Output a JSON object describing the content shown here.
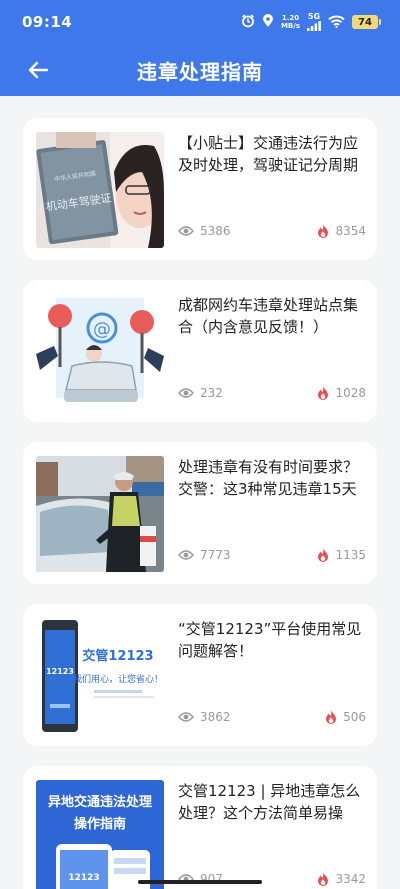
{
  "status_bar": {
    "time": "09:14",
    "net_speed_value": "1.20",
    "net_speed_unit": "MB/s",
    "signal_label": "5G",
    "battery": "74"
  },
  "header": {
    "title": "违章处理指南"
  },
  "colors": {
    "header_bg": "#3f78ea",
    "page_bg": "#f4f5f7",
    "hot_icon": "#ee4d4d"
  },
  "articles": [
    {
      "title": "【小贴士】交通违法行为应及时处理，驾驶证记分周期",
      "views": "5386",
      "hot": "8354",
      "thumb_icon": "license-photo"
    },
    {
      "title": "成都网约车违章处理站点集合（内含意见反馈！）",
      "views": "232",
      "hot": "1028",
      "thumb_icon": "ride-hailing-illustration"
    },
    {
      "title": "处理违章有没有时间要求？交警：这3种常见违章15天",
      "views": "7773",
      "hot": "1135",
      "thumb_icon": "traffic-police-photo"
    },
    {
      "title": "“交管12123”平台使用常见问题解答！",
      "views": "3862",
      "hot": "506",
      "thumb_icon": "app-12123-banner",
      "thumb_text": {
        "app_name": "交管12123",
        "slogan": "我们用心，让您省心！"
      }
    },
    {
      "title": "交管12123 | 异地违章怎么处理？这个方法简单易操",
      "views": "907",
      "hot": "3342",
      "thumb_icon": "remote-violation-banner",
      "thumb_text": {
        "line1": "异地交通违法处理",
        "line2": "操作指南"
      }
    }
  ]
}
